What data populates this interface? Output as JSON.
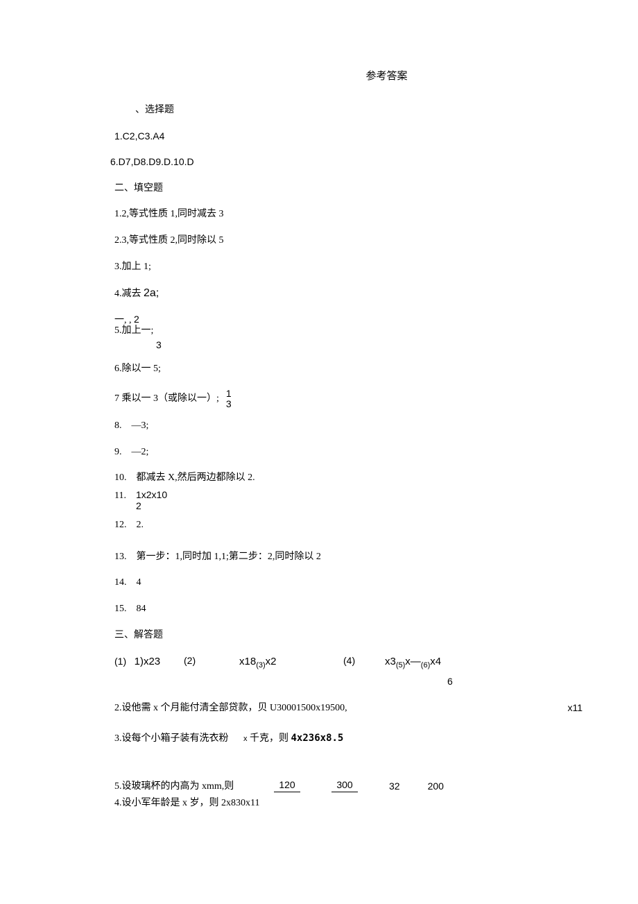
{
  "title": "参考答案",
  "section1": {
    "header": "、选择题",
    "line1": "1.C2,C3.A4",
    "line2": "6.D7,D8.D9.D.10.D"
  },
  "section2": {
    "header": "二、填空题",
    "q1": "1.2,等式性质 1,同时减去 3",
    "q2": "2.3,等式性质 2,同时除以 5",
    "q3": "3.加上 1;",
    "q4_prefix": "4.减去 ",
    "q4_suffix": "2a;",
    "q5_topline": "一, , ",
    "q5_topnum": "2",
    "q5_prefix": "5.加上一;",
    "q5_denom": "3",
    "q6": "6.除以一 5;",
    "q7_prefix": "7 乘以一 3（或除以一）;",
    "q7_top": "1",
    "q7_bot": "3",
    "q8": "8.    —3;",
    "q9": "9.    —2;",
    "q10": "10.    都减去 X,然后两边都除以 2.",
    "q11_num": "11.",
    "q11_top": "1x2x10",
    "q11_bot": "2",
    "q12": "12.    2.",
    "q13": "13.    第一步：1,同时加 1,1;第二步：2,同时除以 2",
    "q14": "14.    4",
    "q15": "15.    84"
  },
  "section3": {
    "header": "三、解答题",
    "row1": {
      "a_paren": "(1)",
      "a_val": "1)x23",
      "b_paren": "(2)",
      "b_val": "x18",
      "b_sub": "(3)",
      "b_tail": "x2",
      "d_paren": "(4)",
      "d_val": "x3",
      "d_sub1": "(5)",
      "d_mid": "x—",
      "d_sub2": "(6)",
      "d_tail": "x4"
    },
    "trail6": "6",
    "q2_left": "2.设他需 x 个月能付清全部贷款，贝 U30001500x19500,",
    "q2_right": "x11",
    "q3_prefix": "3.设每个小箱子装有洗衣粉",
    "q3_mid": "x",
    "q3_suffix": " 千克，则 ",
    "q3_mono": "4x236x8.5",
    "q5_label": "5.设玻璃杯的内高为 xmm,则",
    "q5_f1": "120",
    "q5_f2": "300",
    "q5_n1": "32",
    "q5_n2": "200",
    "q4": "4.设小军年龄是 x 岁，则 2x830x11"
  }
}
